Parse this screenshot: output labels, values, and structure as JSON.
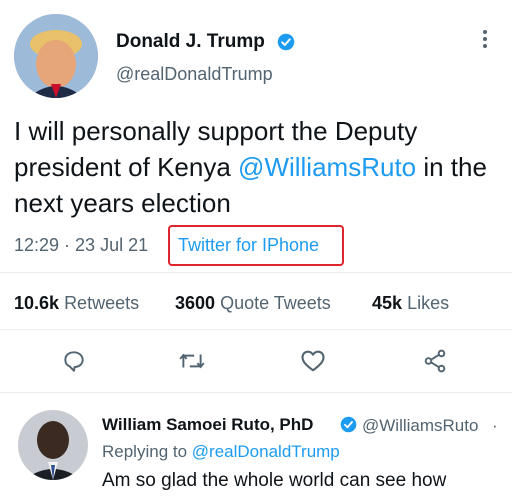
{
  "tweet": {
    "author_name": "Donald J. Trump",
    "author_handle": "@realDonaldTrump",
    "text_before": "I will personally support the Deputy president of Kenya ",
    "mention": "@WilliamsRuto",
    "text_after": " in the next years election",
    "time": "12:29 · 23 Jul 21",
    "source": "Twitter for IPhone",
    "stats": {
      "retweets_count": "10.6k",
      "retweets_label": "Retweets",
      "quotes_count": "3600",
      "quotes_label": "Quote Tweets",
      "likes_count": "45k",
      "likes_label": "Likes"
    }
  },
  "reply": {
    "author_name": "William Samoei Ruto, PhD",
    "author_handle": "@WilliamsRuto",
    "more": "·",
    "replying_to_label": "Replying to",
    "replying_to_handle": "@realDonaldTrump",
    "text": "Am so glad the whole world can see how"
  },
  "colors": {
    "accent": "#1d9bf0",
    "highlight_box": "#e0242b",
    "muted": "#536471"
  },
  "icons": [
    "more-icon",
    "verified-icon",
    "reply-icon",
    "retweet-icon",
    "like-icon",
    "share-icon"
  ]
}
